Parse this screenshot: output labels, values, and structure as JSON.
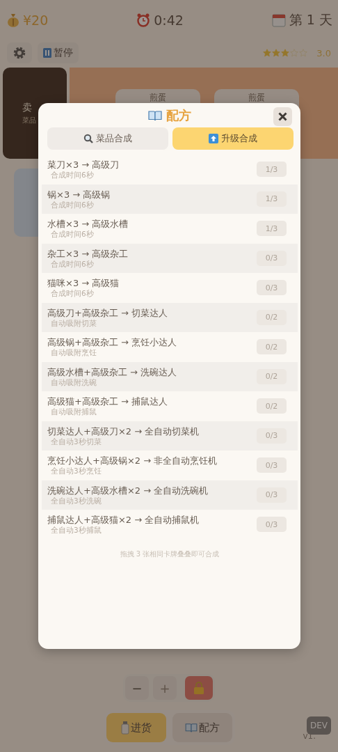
{
  "header": {
    "money": "¥20",
    "timer": "0:42",
    "day": "第 1 天"
  },
  "toolbar": {
    "pause_label": "暂停",
    "stars": 3,
    "rating": "3.0"
  },
  "sell_card": {
    "title": "卖",
    "subtitle": "菜品"
  },
  "dish_cards": [
    {
      "name": "煎蛋"
    },
    {
      "name": "煎蛋"
    }
  ],
  "dialog": {
    "title": "配方",
    "tabs": [
      {
        "label": "菜品合成",
        "selected": false,
        "kind": "search"
      },
      {
        "label": "升级合成",
        "selected": true,
        "kind": "upgrade"
      }
    ],
    "recipes": [
      {
        "formula": "菜刀×3 → 高级刀",
        "note": "合成时间6秒",
        "progress": "1/3"
      },
      {
        "formula": "锅×3 → 高级锅",
        "note": "合成时间6秒",
        "progress": "1/3"
      },
      {
        "formula": "水槽×3 → 高级水槽",
        "note": "合成时间6秒",
        "progress": "1/3"
      },
      {
        "formula": "杂工×3 → 高级杂工",
        "note": "合成时间6秒",
        "progress": "0/3"
      },
      {
        "formula": "猫咪×3 → 高级猫",
        "note": "合成时间6秒",
        "progress": "0/3"
      },
      {
        "formula": "高级刀+高级杂工 → 切菜达人",
        "note": "自动吸附切菜",
        "progress": "0/2"
      },
      {
        "formula": "高级锅+高级杂工 → 烹饪小达人",
        "note": "自动吸附烹饪",
        "progress": "0/2"
      },
      {
        "formula": "高级水槽+高级杂工 → 洗碗达人",
        "note": "自动吸附洗碗",
        "progress": "0/2"
      },
      {
        "formula": "高级猫+高级杂工 → 捕鼠达人",
        "note": "自动吸附捕鼠",
        "progress": "0/2"
      },
      {
        "formula": "切菜达人+高级刀×2 → 全自动切菜机",
        "note": "全自动3秒切菜",
        "progress": "0/3"
      },
      {
        "formula": "烹饪小达人+高级锅×2 → 非全自动烹饪机",
        "note": "全自动3秒烹饪",
        "progress": "0/3"
      },
      {
        "formula": "洗碗达人+高级水槽×2 → 全自动洗碗机",
        "note": "全自动3秒洗碗",
        "progress": "0/3"
      },
      {
        "formula": "捕鼠达人+高级猫×2 → 全自动捕鼠机",
        "note": "全自动3秒捕鼠",
        "progress": "0/3"
      }
    ],
    "hint": "拖拽 3 张相同卡牌叠叠即可合成"
  },
  "controls": {
    "minus": "−",
    "plus": "+",
    "plus_disabled": true,
    "locked": true
  },
  "bottom_tabs": [
    {
      "label": "进货",
      "selected": true,
      "kind": "stock"
    },
    {
      "label": "配方",
      "selected": false,
      "kind": "book"
    }
  ],
  "version": "v1.",
  "dev_badge": "DEV"
}
